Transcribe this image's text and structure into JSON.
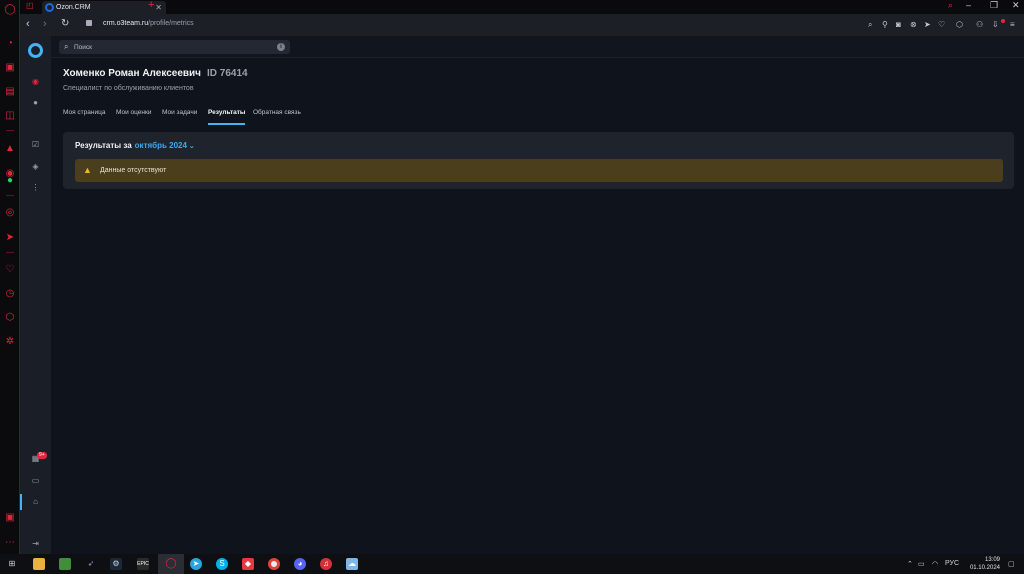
{
  "browser": {
    "tab_title": "Ozon.CRM",
    "url_host": "crm.o3team.ru",
    "url_path": "/profile/metrics"
  },
  "search": {
    "placeholder": "Поиск"
  },
  "profile": {
    "name": "Хоменко Роман Алексеевич",
    "id": "ID 76414",
    "role": "Специалист по обслуживанию клиентов"
  },
  "tabs": [
    {
      "label": "Моя страница"
    },
    {
      "label": "Мои оценки"
    },
    {
      "label": "Мои задачи"
    },
    {
      "label": "Результаты"
    },
    {
      "label": "Обратная связь"
    }
  ],
  "results": {
    "title": "Результаты за",
    "period": "октябрь 2024",
    "empty_message": "Данные отсутствуют"
  },
  "sidebar": {
    "badge": "9+"
  },
  "taskbar": {
    "language": "РУС",
    "time": "13:09",
    "date": "01.10.2024"
  },
  "colors": {
    "accent": "#41b4f4",
    "warning_bg": "#4a3e1c",
    "warning_icon": "#f3b51d",
    "opera_red": "#e3263d"
  }
}
